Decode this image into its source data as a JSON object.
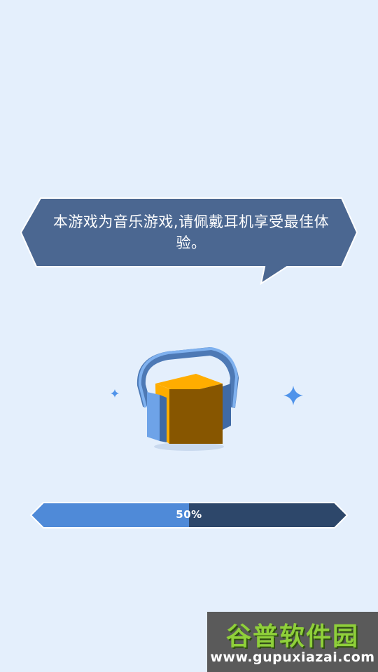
{
  "dialog": {
    "message": "本游戏为音乐游戏,请佩戴耳机享受最佳体验。"
  },
  "loading": {
    "progress_fraction": 0.5,
    "progress_label": "50%"
  },
  "watermark": {
    "logo_text": "谷普软件园",
    "url": "www.gupuxiazai.com"
  },
  "colors": {
    "background": "#e4effc",
    "bubble": "#4b6791",
    "cube_top": "#ffad00",
    "cube_side": "#875600",
    "headphone": "#5d8fd0",
    "progress_fill": "#4f8ad8",
    "progress_track": "#2d476a",
    "sparkle": "#4f93ea"
  },
  "icons": [
    "headphone-cube-icon",
    "sparkle-icon"
  ]
}
